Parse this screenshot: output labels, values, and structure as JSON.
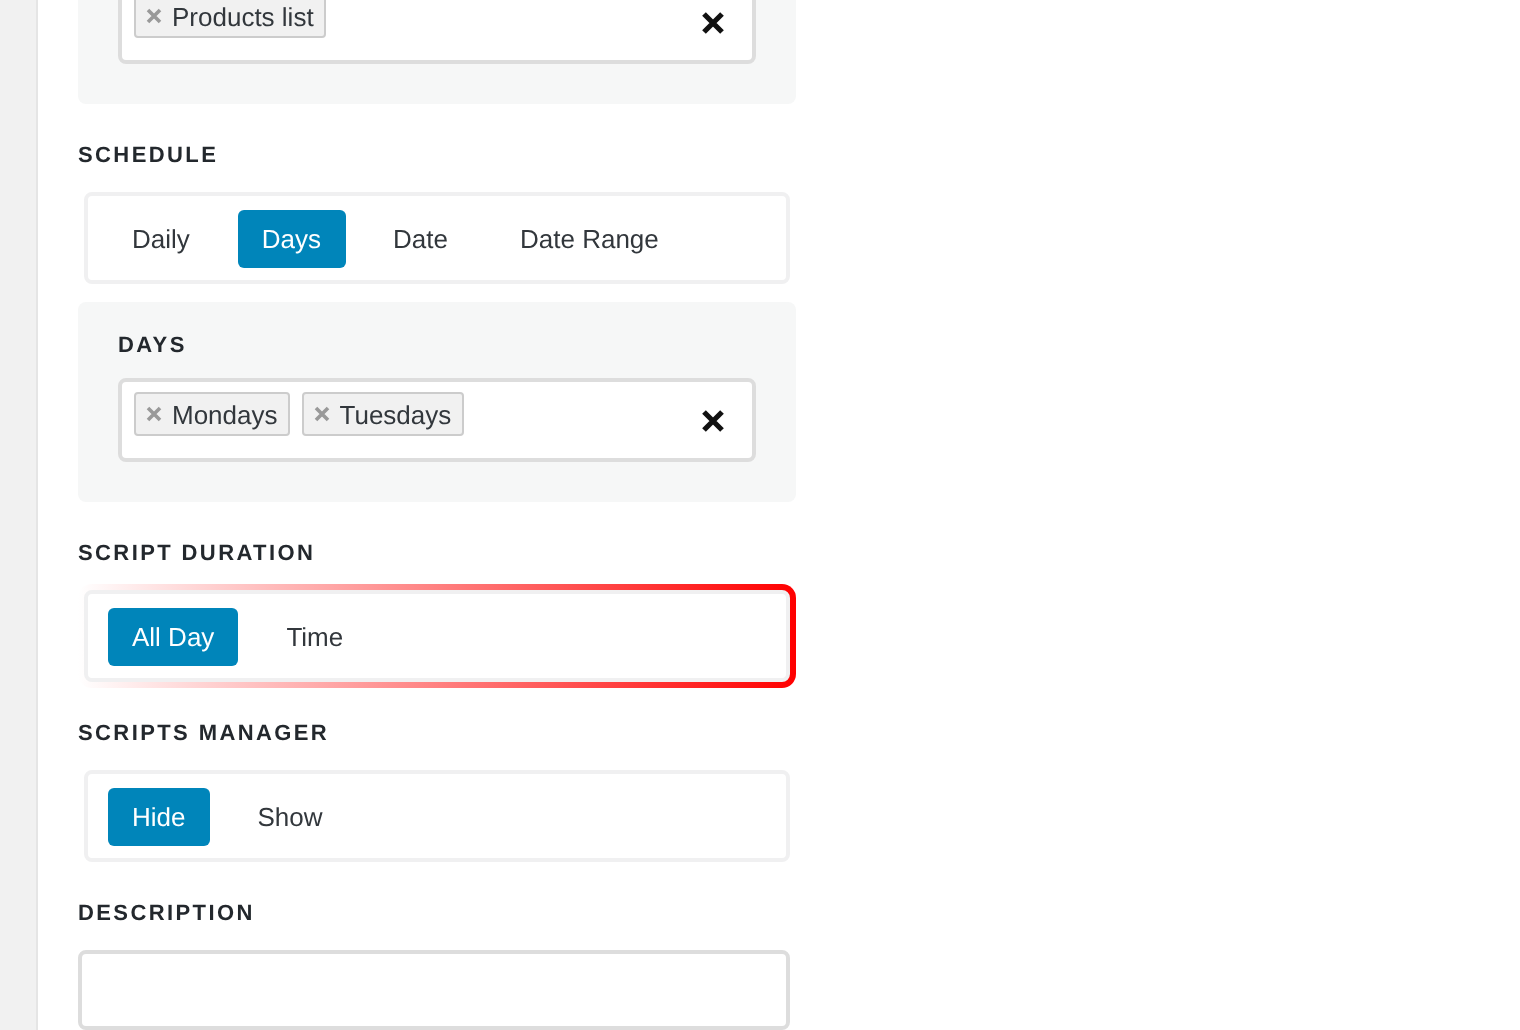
{
  "top_field": {
    "tags": [
      "Products list"
    ]
  },
  "schedule": {
    "label": "SCHEDULE",
    "options": [
      {
        "label": "Daily",
        "selected": false
      },
      {
        "label": "Days",
        "selected": true
      },
      {
        "label": "Date",
        "selected": false
      },
      {
        "label": "Date Range",
        "selected": false
      }
    ]
  },
  "days": {
    "label": "DAYS",
    "tags": [
      "Mondays",
      "Tuesdays"
    ]
  },
  "script_duration": {
    "label": "SCRIPT DURATION",
    "highlighted": true,
    "options": [
      {
        "label": "All Day",
        "selected": true
      },
      {
        "label": "Time",
        "selected": false
      }
    ]
  },
  "scripts_manager": {
    "label": "SCRIPTS MANAGER",
    "options": [
      {
        "label": "Hide",
        "selected": true
      },
      {
        "label": "Show",
        "selected": false
      }
    ]
  },
  "description": {
    "label": "DESCRIPTION"
  }
}
